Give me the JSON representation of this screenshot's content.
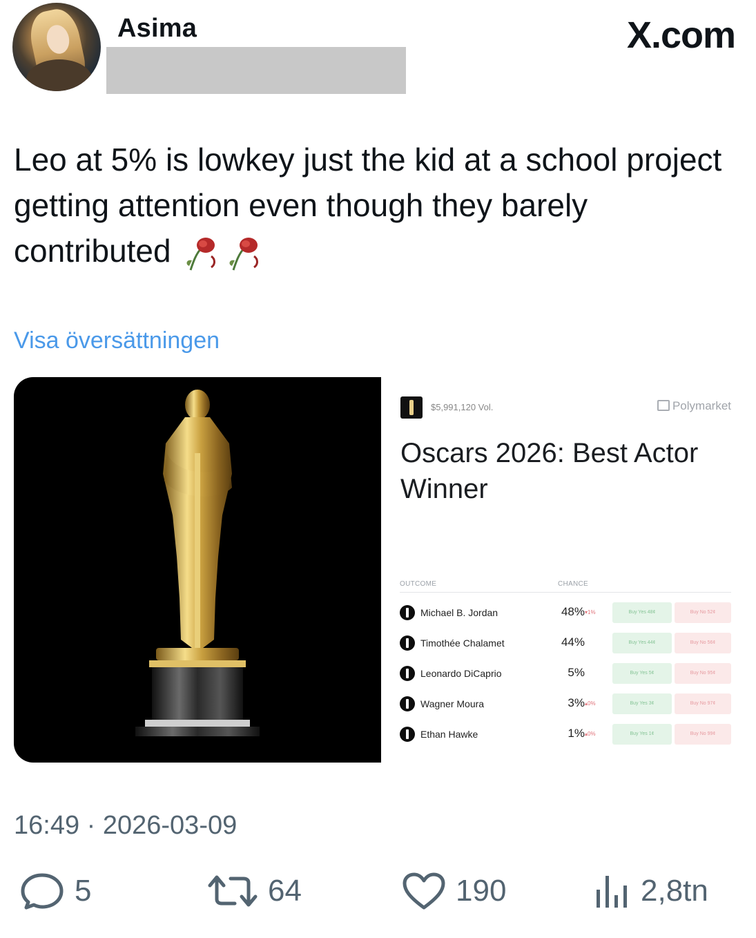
{
  "author": {
    "display_name": "Asima",
    "handle": ""
  },
  "site": {
    "logo_text": "X.com"
  },
  "tweet": {
    "text": "Leo at 5% is lowkey just the kid at a school project getting attention even though they barely contributed",
    "emoji": [
      "wilted-rose",
      "wilted-rose"
    ],
    "translate_label": "Visa översättningen",
    "timestamp": "16:49 · 2026-03-09"
  },
  "polymarket": {
    "volume": "$5,991,120 Vol.",
    "brand": "Polymarket",
    "title": "Oscars 2026: Best Actor Winner",
    "columns": {
      "outcome": "OUTCOME",
      "chance": "CHANCE"
    },
    "rows": [
      {
        "name": "Michael B. Jordan",
        "chance": "48%",
        "delta": "▾1%",
        "delta_color": "#e0737a",
        "yes": "Buy Yes 48¢",
        "no": "Buy No 52¢"
      },
      {
        "name": "Timothée Chalamet",
        "chance": "44%",
        "delta": "",
        "delta_color": "#9ba1a8",
        "yes": "Buy Yes 44¢",
        "no": "Buy No 56¢"
      },
      {
        "name": "Leonardo DiCaprio",
        "chance": "5%",
        "delta": "",
        "delta_color": "#9ba1a8",
        "yes": "Buy Yes 5¢",
        "no": "Buy No 95¢"
      },
      {
        "name": "Wagner Moura",
        "chance": "3%",
        "delta": "▴0%",
        "delta_color": "#e0737a",
        "yes": "Buy Yes 3¢",
        "no": "Buy No 97¢"
      },
      {
        "name": "Ethan Hawke",
        "chance": "1%",
        "delta": "▴0%",
        "delta_color": "#e0737a",
        "yes": "Buy Yes 1¢",
        "no": "Buy No 99¢"
      }
    ]
  },
  "actions": {
    "replies": "5",
    "reposts": "64",
    "likes": "190",
    "views": "2,8tn"
  },
  "colors": {
    "link": "#4a99e9",
    "muted": "#536471",
    "text": "#0f1419"
  }
}
